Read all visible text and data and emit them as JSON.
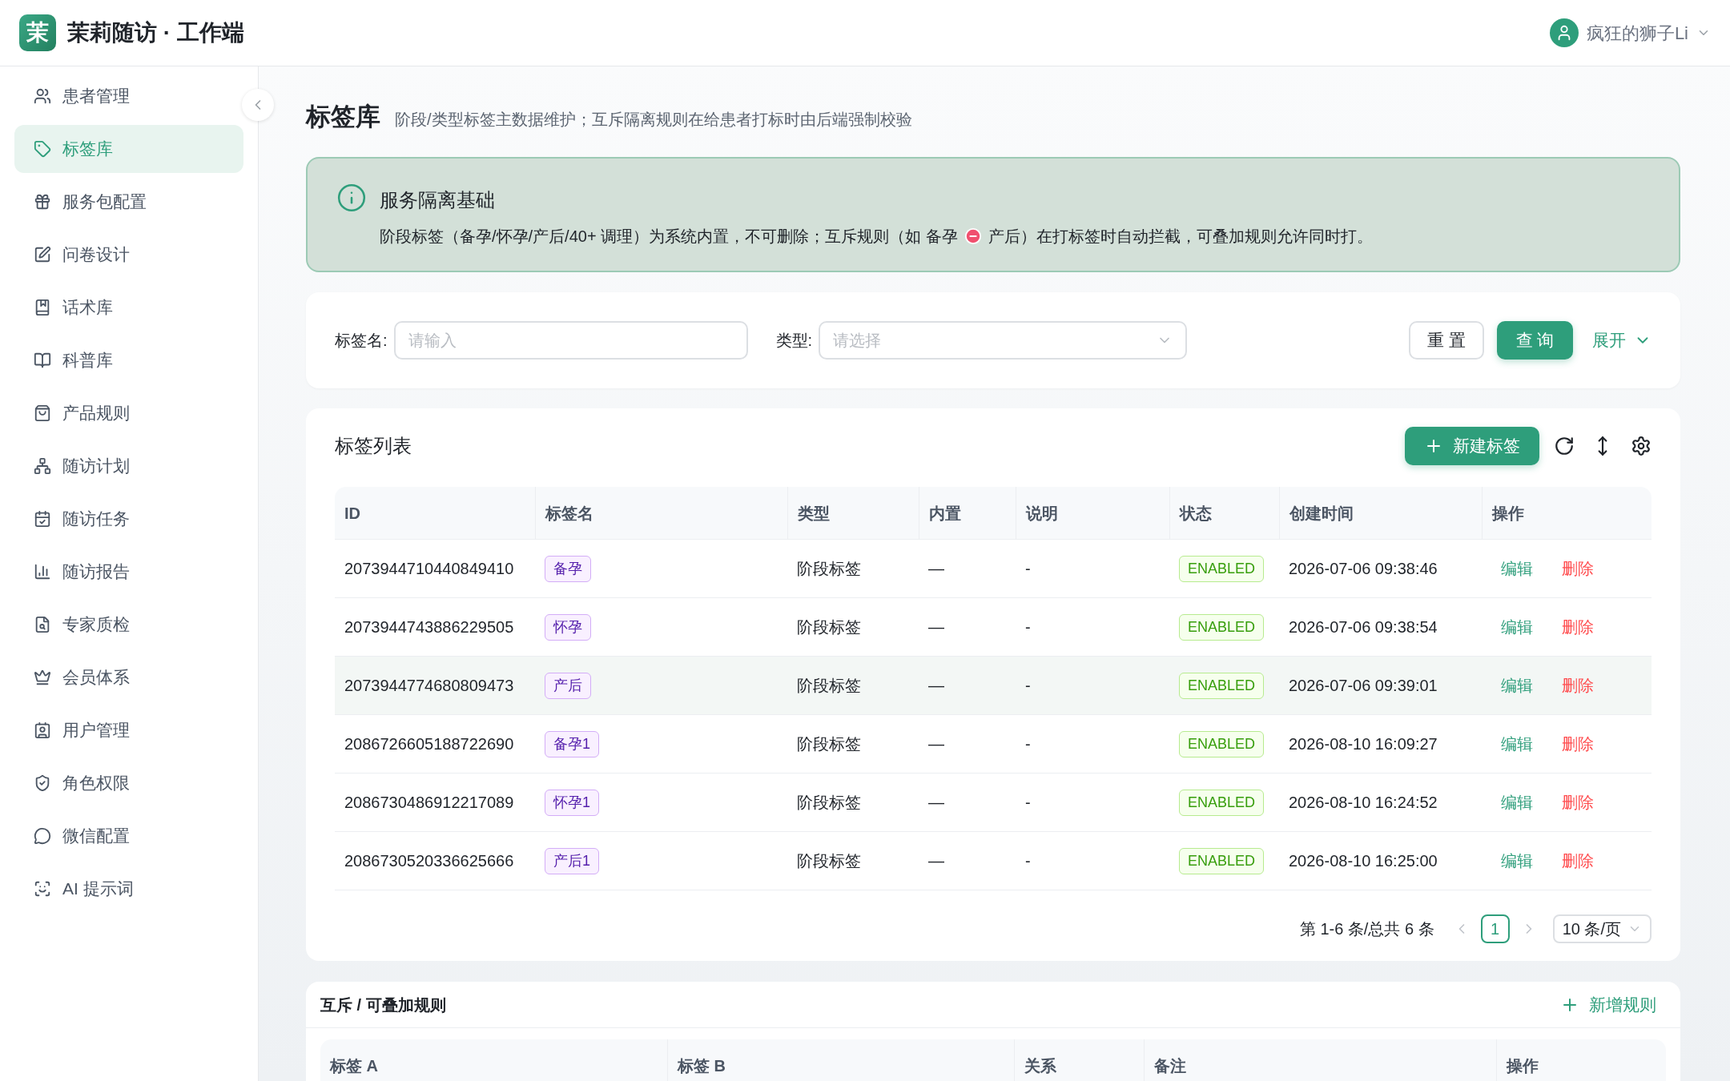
{
  "app": {
    "logo_char": "茉",
    "title": "茉莉随访 · 工作端",
    "user_name": "疯狂的狮子Li"
  },
  "sidebar": {
    "items": [
      {
        "label": "患者管理",
        "selected": false
      },
      {
        "label": "标签库",
        "selected": true
      },
      {
        "label": "服务包配置",
        "selected": false
      },
      {
        "label": "问卷设计",
        "selected": false
      },
      {
        "label": "话术库",
        "selected": false
      },
      {
        "label": "科普库",
        "selected": false
      },
      {
        "label": "产品规则",
        "selected": false
      },
      {
        "label": "随访计划",
        "selected": false
      },
      {
        "label": "随访任务",
        "selected": false
      },
      {
        "label": "随访报告",
        "selected": false
      },
      {
        "label": "专家质检",
        "selected": false
      },
      {
        "label": "会员体系",
        "selected": false
      },
      {
        "label": "用户管理",
        "selected": false
      },
      {
        "label": "角色权限",
        "selected": false
      },
      {
        "label": "微信配置",
        "selected": false
      },
      {
        "label": "AI 提示词",
        "selected": false
      }
    ]
  },
  "page": {
    "title": "标签库",
    "subtitle": "阶段/类型标签主数据维护；互斥隔离规则在给患者打标时由后端强制校验"
  },
  "alert": {
    "title": "服务隔离基础",
    "description_before": "阶段标签（备孕/怀孕/产后/40+ 调理）为系统内置，不可删除；互斥规则（如 备孕",
    "description_after": "产后）在打标签时自动拦截，可叠加规则允许同时打。"
  },
  "filter": {
    "fields": [
      {
        "label": "标签名:",
        "placeholder": "请输入",
        "kind": "input"
      },
      {
        "label": "类型:",
        "placeholder": "请选择",
        "kind": "select"
      }
    ],
    "reset": "重 置",
    "search": "查 询",
    "expand": "展开"
  },
  "table": {
    "title": "标签列表",
    "new_button": "新建标签",
    "columns": [
      "ID",
      "标签名",
      "类型",
      "内置",
      "说明",
      "状态",
      "创建时间",
      "操作"
    ],
    "rows": [
      {
        "id": "2073944710440849410",
        "name": "备孕",
        "type": "阶段标签",
        "builtin": "—",
        "note": "-",
        "status": "ENABLED",
        "created": "2026-07-06 09:38:46",
        "edit": "编辑",
        "delete": "删除",
        "hovered": false
      },
      {
        "id": "2073944743886229505",
        "name": "怀孕",
        "type": "阶段标签",
        "builtin": "—",
        "note": "-",
        "status": "ENABLED",
        "created": "2026-07-06 09:38:54",
        "edit": "编辑",
        "delete": "删除",
        "hovered": false
      },
      {
        "id": "2073944774680809473",
        "name": "产后",
        "type": "阶段标签",
        "builtin": "—",
        "note": "-",
        "status": "ENABLED",
        "created": "2026-07-06 09:39:01",
        "edit": "编辑",
        "delete": "删除",
        "hovered": true
      },
      {
        "id": "2086726605188722690",
        "name": "备孕1",
        "type": "阶段标签",
        "builtin": "—",
        "note": "-",
        "status": "ENABLED",
        "created": "2026-08-10 16:09:27",
        "edit": "编辑",
        "delete": "删除",
        "hovered": false
      },
      {
        "id": "2086730486912217089",
        "name": "怀孕1",
        "type": "阶段标签",
        "builtin": "—",
        "note": "-",
        "status": "ENABLED",
        "created": "2026-08-10 16:24:52",
        "edit": "编辑",
        "delete": "删除",
        "hovered": false
      },
      {
        "id": "2086730520336625666",
        "name": "产后1",
        "type": "阶段标签",
        "builtin": "—",
        "note": "-",
        "status": "ENABLED",
        "created": "2026-08-10 16:25:00",
        "edit": "编辑",
        "delete": "删除",
        "hovered": false
      }
    ],
    "pagination": {
      "summary": "第 1-6 条/总共 6 条",
      "pages": [
        {
          "label": "1",
          "selected": true
        }
      ],
      "page_size": "10 条/页"
    }
  },
  "rules": {
    "title": "互斥 / 可叠加规则",
    "add_button": "新增规则",
    "columns": [
      "标签 A",
      "标签 B",
      "关系",
      "备注",
      "操作"
    ]
  }
}
